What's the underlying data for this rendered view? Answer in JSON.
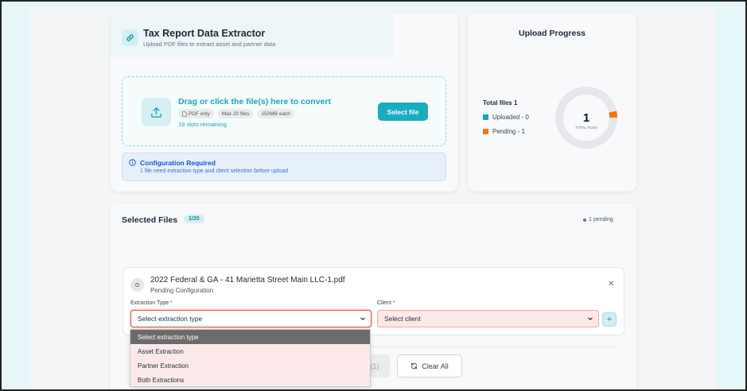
{
  "upload": {
    "title": "Tax Report Data Extractor",
    "subtitle": "Upload PDF files to extract asset and partner data",
    "drop_title": "Drag or click the file(s) here to convert",
    "chips": [
      "PDF only",
      "Max 20 files",
      "150MB each"
    ],
    "slots": "19 slots remaining",
    "select_button": "Select file",
    "config_title": "Configuration Required",
    "config_message": "1 file need extraction type and client selection before upload"
  },
  "progress": {
    "title": "Upload Progress",
    "total_label": "Total files 1",
    "uploaded_label": "Uploaded - 0",
    "pending_label": "Pending - 1",
    "center_value": "1",
    "center_caption": "TOTAL FILES",
    "uploaded_count": 0,
    "pending_count": 1,
    "total_count": 1,
    "colors": {
      "uploaded": "#16a8b9",
      "pending": "#f97316",
      "track": "#e5e7eb"
    }
  },
  "files": {
    "title": "Selected Files",
    "count": "1/20",
    "pending_tag": "1 pending",
    "items": [
      {
        "name": "2022 Federal & GA - 41 Marietta Street Main LLC-1.pdf",
        "status": "Pending Configuration",
        "extraction_label": "Extraction Type",
        "extraction_value": "Select extraction type",
        "client_label": "Client",
        "client_value": "Select client"
      }
    ],
    "upload_partial_label": "(1)",
    "clear_label": "Clear All"
  },
  "dropdown": {
    "options": [
      "Select extraction type",
      "Asset Extraction",
      "Partner Extraction",
      "Both Extractions"
    ],
    "selected_index": 0
  }
}
